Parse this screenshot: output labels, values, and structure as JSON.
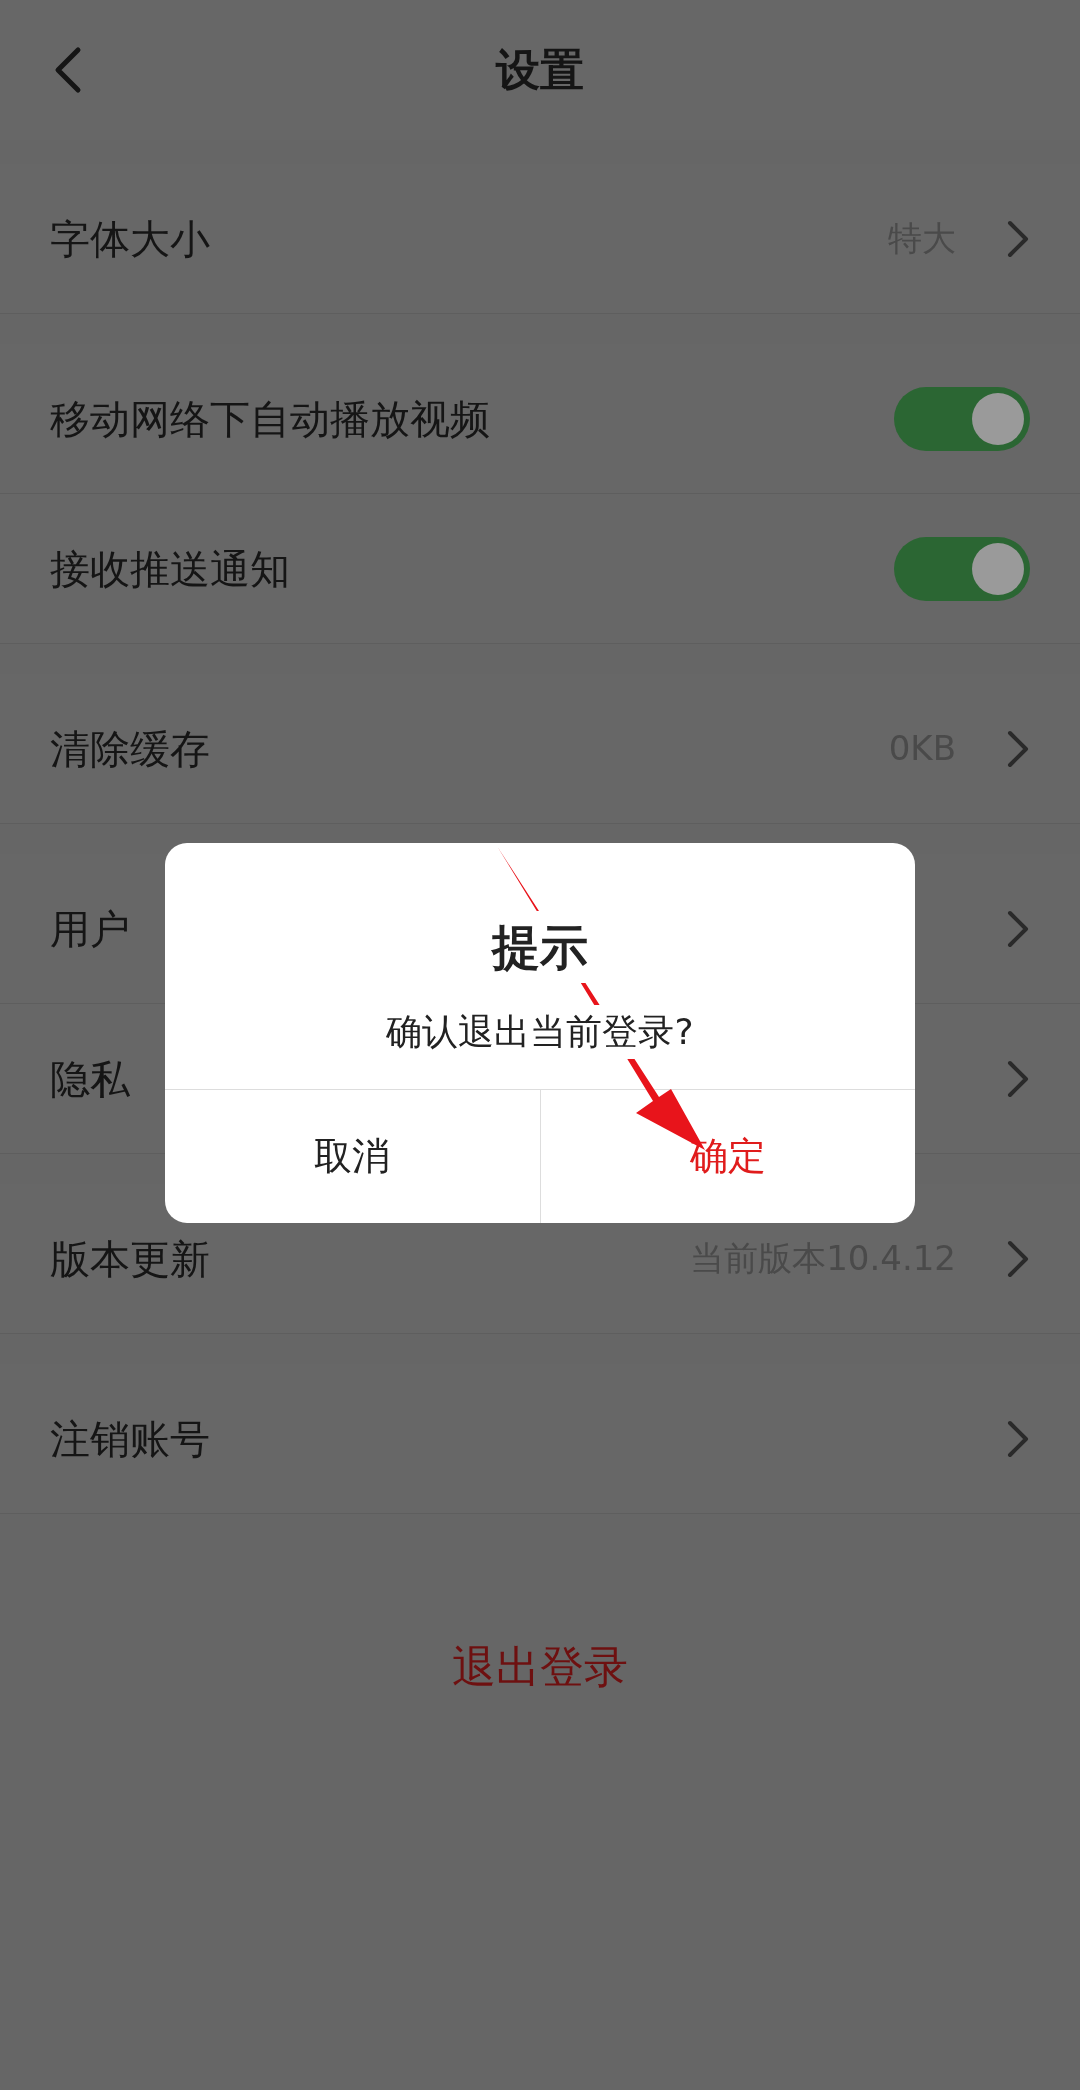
{
  "header": {
    "title": "设置"
  },
  "groups": [
    [
      {
        "kind": "link",
        "label": "字体大小",
        "value": "特大"
      }
    ],
    [
      {
        "kind": "toggle",
        "label": "移动网络下自动播放视频",
        "on": true
      },
      {
        "kind": "toggle",
        "label": "接收推送通知",
        "on": true
      }
    ],
    [
      {
        "kind": "link",
        "label": "清除缓存",
        "value": "0KB"
      }
    ],
    [
      {
        "kind": "link",
        "label": "用户"
      },
      {
        "kind": "link",
        "label": "隐私"
      }
    ],
    [
      {
        "kind": "link",
        "label": "版本更新",
        "value": "当前版本10.4.12"
      }
    ],
    [
      {
        "kind": "link",
        "label": "注销账号"
      }
    ]
  ],
  "logout": "退出登录",
  "dialog": {
    "title": "提示",
    "message": "确认退出当前登录?",
    "buttons": [
      {
        "kind": "cancel",
        "label": "取消"
      },
      {
        "kind": "confirm",
        "label": "确定"
      }
    ]
  }
}
